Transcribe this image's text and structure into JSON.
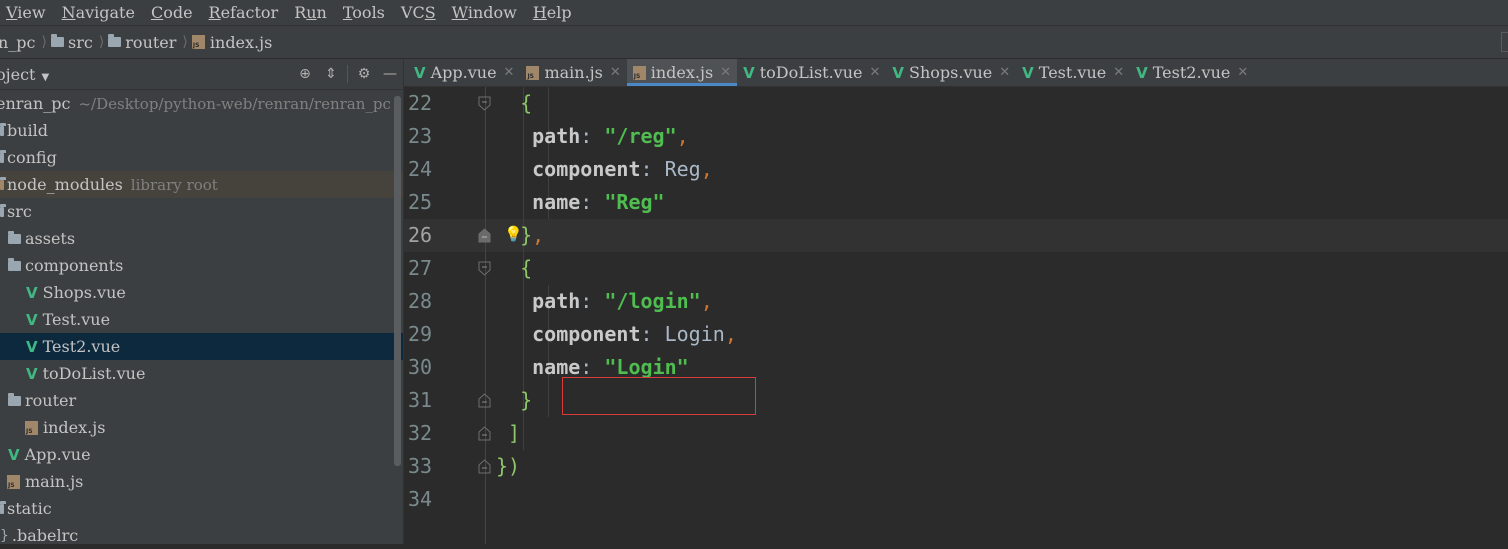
{
  "menu": [
    {
      "pre": "",
      "u": "V",
      "post": "iew"
    },
    {
      "pre": "",
      "u": "N",
      "post": "avigate"
    },
    {
      "pre": "",
      "u": "C",
      "post": "ode"
    },
    {
      "pre": "",
      "u": "R",
      "post": "efactor"
    },
    {
      "pre": "R",
      "u": "u",
      "post": "n"
    },
    {
      "pre": "",
      "u": "T",
      "post": "ools"
    },
    {
      "pre": "VC",
      "u": "S",
      "post": ""
    },
    {
      "pre": "",
      "u": "W",
      "post": "indow"
    },
    {
      "pre": "",
      "u": "H",
      "post": "elp"
    }
  ],
  "breadcrumb": {
    "project": "n_pc",
    "folder1": "src",
    "folder2": "router",
    "file": "index.js"
  },
  "sidebar": {
    "title": "oject",
    "root_name": "enran_pc",
    "root_path": "~/Desktop/python-web/renran/renran_pc",
    "items": [
      {
        "label": "build",
        "hint": ""
      },
      {
        "label": "config",
        "hint": ""
      },
      {
        "label": "node_modules",
        "hint": "library root"
      },
      {
        "label": "src",
        "hint": ""
      },
      {
        "label": "assets",
        "hint": ""
      },
      {
        "label": "components",
        "hint": ""
      },
      {
        "label": "Shops.vue",
        "hint": ""
      },
      {
        "label": "Test.vue",
        "hint": ""
      },
      {
        "label": "Test2.vue",
        "hint": ""
      },
      {
        "label": "toDoList.vue",
        "hint": ""
      },
      {
        "label": "router",
        "hint": ""
      },
      {
        "label": "index.js",
        "hint": ""
      },
      {
        "label": "App.vue",
        "hint": ""
      },
      {
        "label": "main.js",
        "hint": ""
      },
      {
        "label": "static",
        "hint": ""
      },
      {
        "label": ".babelrc",
        "hint": ""
      }
    ]
  },
  "tabs": [
    {
      "label": "App.vue"
    },
    {
      "label": "main.js"
    },
    {
      "label": "index.js"
    },
    {
      "label": "toDoList.vue"
    },
    {
      "label": "Shops.vue"
    },
    {
      "label": "Test.vue"
    },
    {
      "label": "Test2.vue"
    }
  ],
  "code": {
    "line_numbers": [
      "22",
      "23",
      "24",
      "25",
      "26",
      "27",
      "28",
      "29",
      "30",
      "31",
      "32",
      "33",
      "34"
    ],
    "current_line": "26",
    "key_path": "path",
    "key_component": "component",
    "key_name": "name",
    "val_reg_path": "\"/reg\"",
    "val_reg_component": "Reg",
    "val_reg_name": "\"Reg\"",
    "val_login_path": "\"/login\"",
    "val_login_component": "Login",
    "val_login_name": "\"Login\""
  },
  "colors": {
    "accent": "#4a88c7",
    "highlight_box": "#d93a3a",
    "string": "#4fbd4f",
    "vue": "#41b883"
  }
}
